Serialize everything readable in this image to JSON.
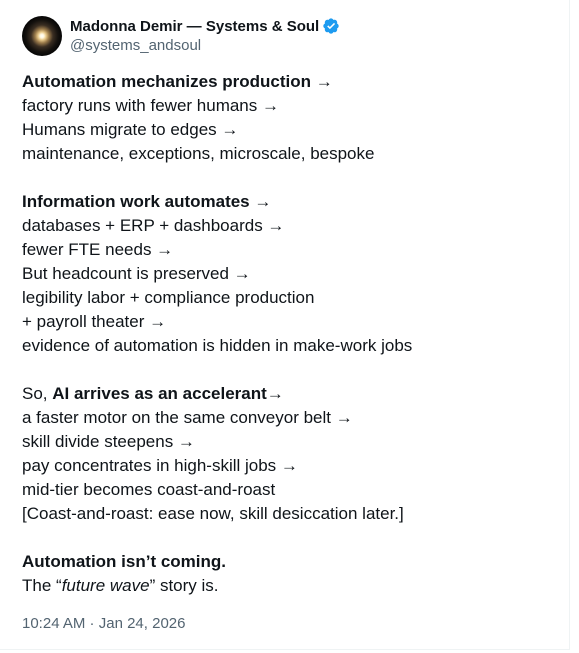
{
  "author": {
    "display_name": "Madonna Demir — Systems & Soul",
    "handle": "@systems_andsoul",
    "verified": true,
    "avatar_icon": "glowing-orb-avatar",
    "verified_color": "#1d9bf0"
  },
  "post": {
    "block1": {
      "l1": {
        "bold": "Automation mechanizes production",
        "rest": " →"
      },
      "l2": "factory runs with fewer humans →",
      "l3": "Humans migrate to edges →",
      "l4": "maintenance, exceptions, microscale, bespoke"
    },
    "block2": {
      "l1": {
        "bold": "Information work automates",
        "rest": " →"
      },
      "l2": "databases + ERP + dashboards →",
      "l3": "fewer FTE needs →",
      "l4": "But headcount is preserved →",
      "l5": "legibility labor + compliance production",
      "l6": "+ payroll theater →",
      "l7": "evidence of automation is hidden in make-work jobs"
    },
    "block3": {
      "l1": {
        "pre": "So, ",
        "bold": "AI arrives as an accelerant",
        "rest": "→"
      },
      "l2": "a faster motor on the same conveyor belt →",
      "l3": "skill divide steepens →",
      "l4": "pay concentrates in high-skill jobs →",
      "l5": "mid-tier becomes coast-and-roast",
      "l6": "[Coast-and-roast: ease now, skill desiccation later.]"
    },
    "block4": {
      "l1": {
        "bold": "Automation isn’t coming."
      },
      "l2": {
        "pre": "The “",
        "italic": "future wave",
        "rest": "” story is."
      }
    }
  },
  "meta": {
    "time": "10:24 AM",
    "separator": " · ",
    "date": "Jan 24, 2026"
  }
}
